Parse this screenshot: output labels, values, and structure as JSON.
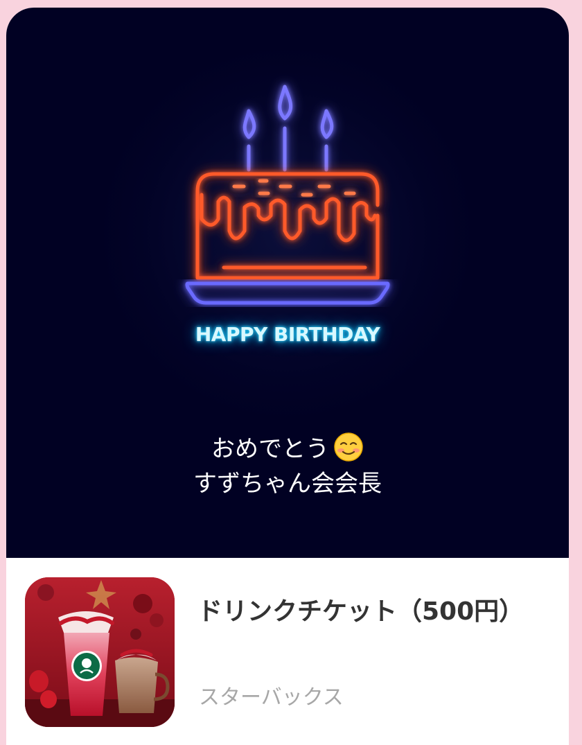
{
  "hero": {
    "neon_text": "HAPPY BIRTHDAY",
    "message_line1": "おめでとう",
    "message_line2": "すずちゃん会会長",
    "emoji_icon": "smiling-face-icon",
    "colors": {
      "background": "#010123",
      "candle": "#5e5bff",
      "cake": "#ff5a2a",
      "plate": "#6b6bff",
      "neon_text": "#2fd6ff"
    }
  },
  "product": {
    "title": "ドリンクチケット（500円）",
    "brand": "スターバックス",
    "thumbnail_icon": "starbucks-drinks-image"
  },
  "colors": {
    "page_background": "#f9d3de",
    "title_text": "#333333",
    "brand_text": "#a7a7a7"
  }
}
